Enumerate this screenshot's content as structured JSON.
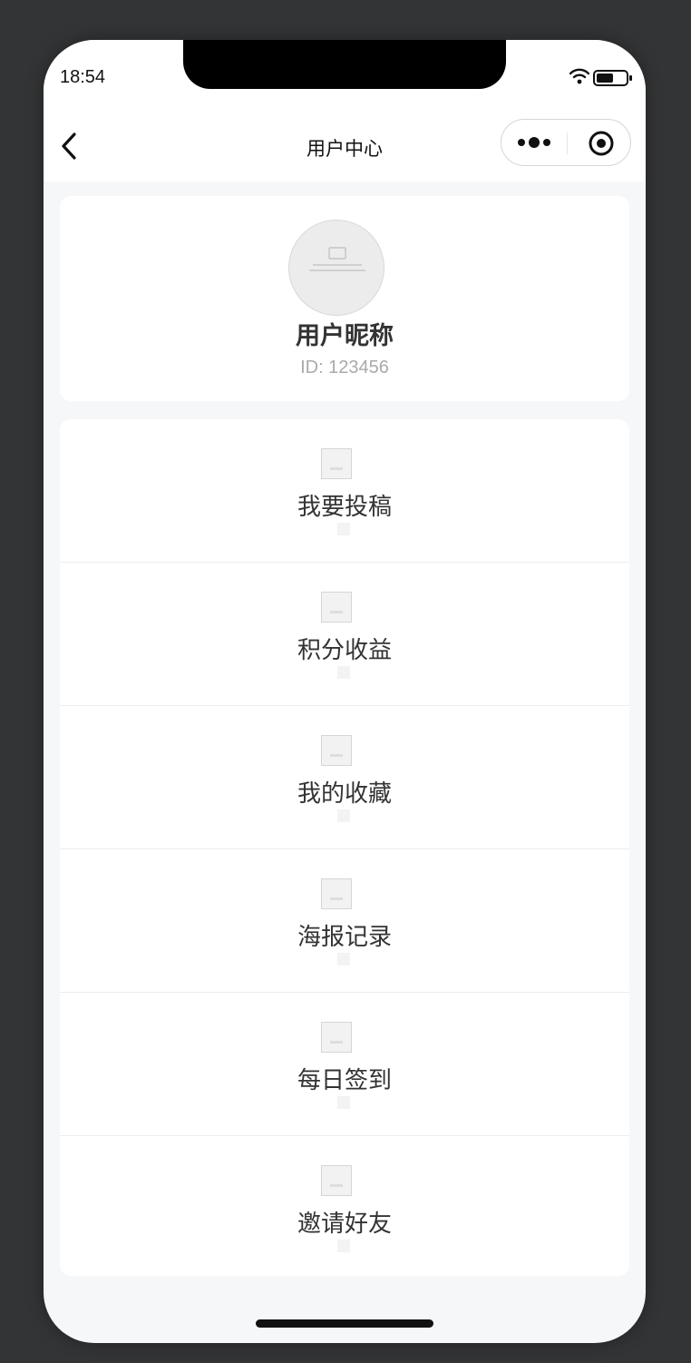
{
  "status_bar": {
    "time": "18:54"
  },
  "nav": {
    "title": "用户中心"
  },
  "profile": {
    "nickname": "用户昵称",
    "id_text": "ID: 123456"
  },
  "menu": {
    "items": [
      {
        "label": "我要投稿"
      },
      {
        "label": "积分收益"
      },
      {
        "label": "我的收藏"
      },
      {
        "label": "海报记录"
      },
      {
        "label": "每日签到"
      },
      {
        "label": "邀请好友"
      }
    ]
  },
  "colors": {
    "page_background": "#f6f7f9",
    "card_background": "#ffffff",
    "text_primary": "#333333",
    "text_secondary": "#aaaaaa"
  }
}
